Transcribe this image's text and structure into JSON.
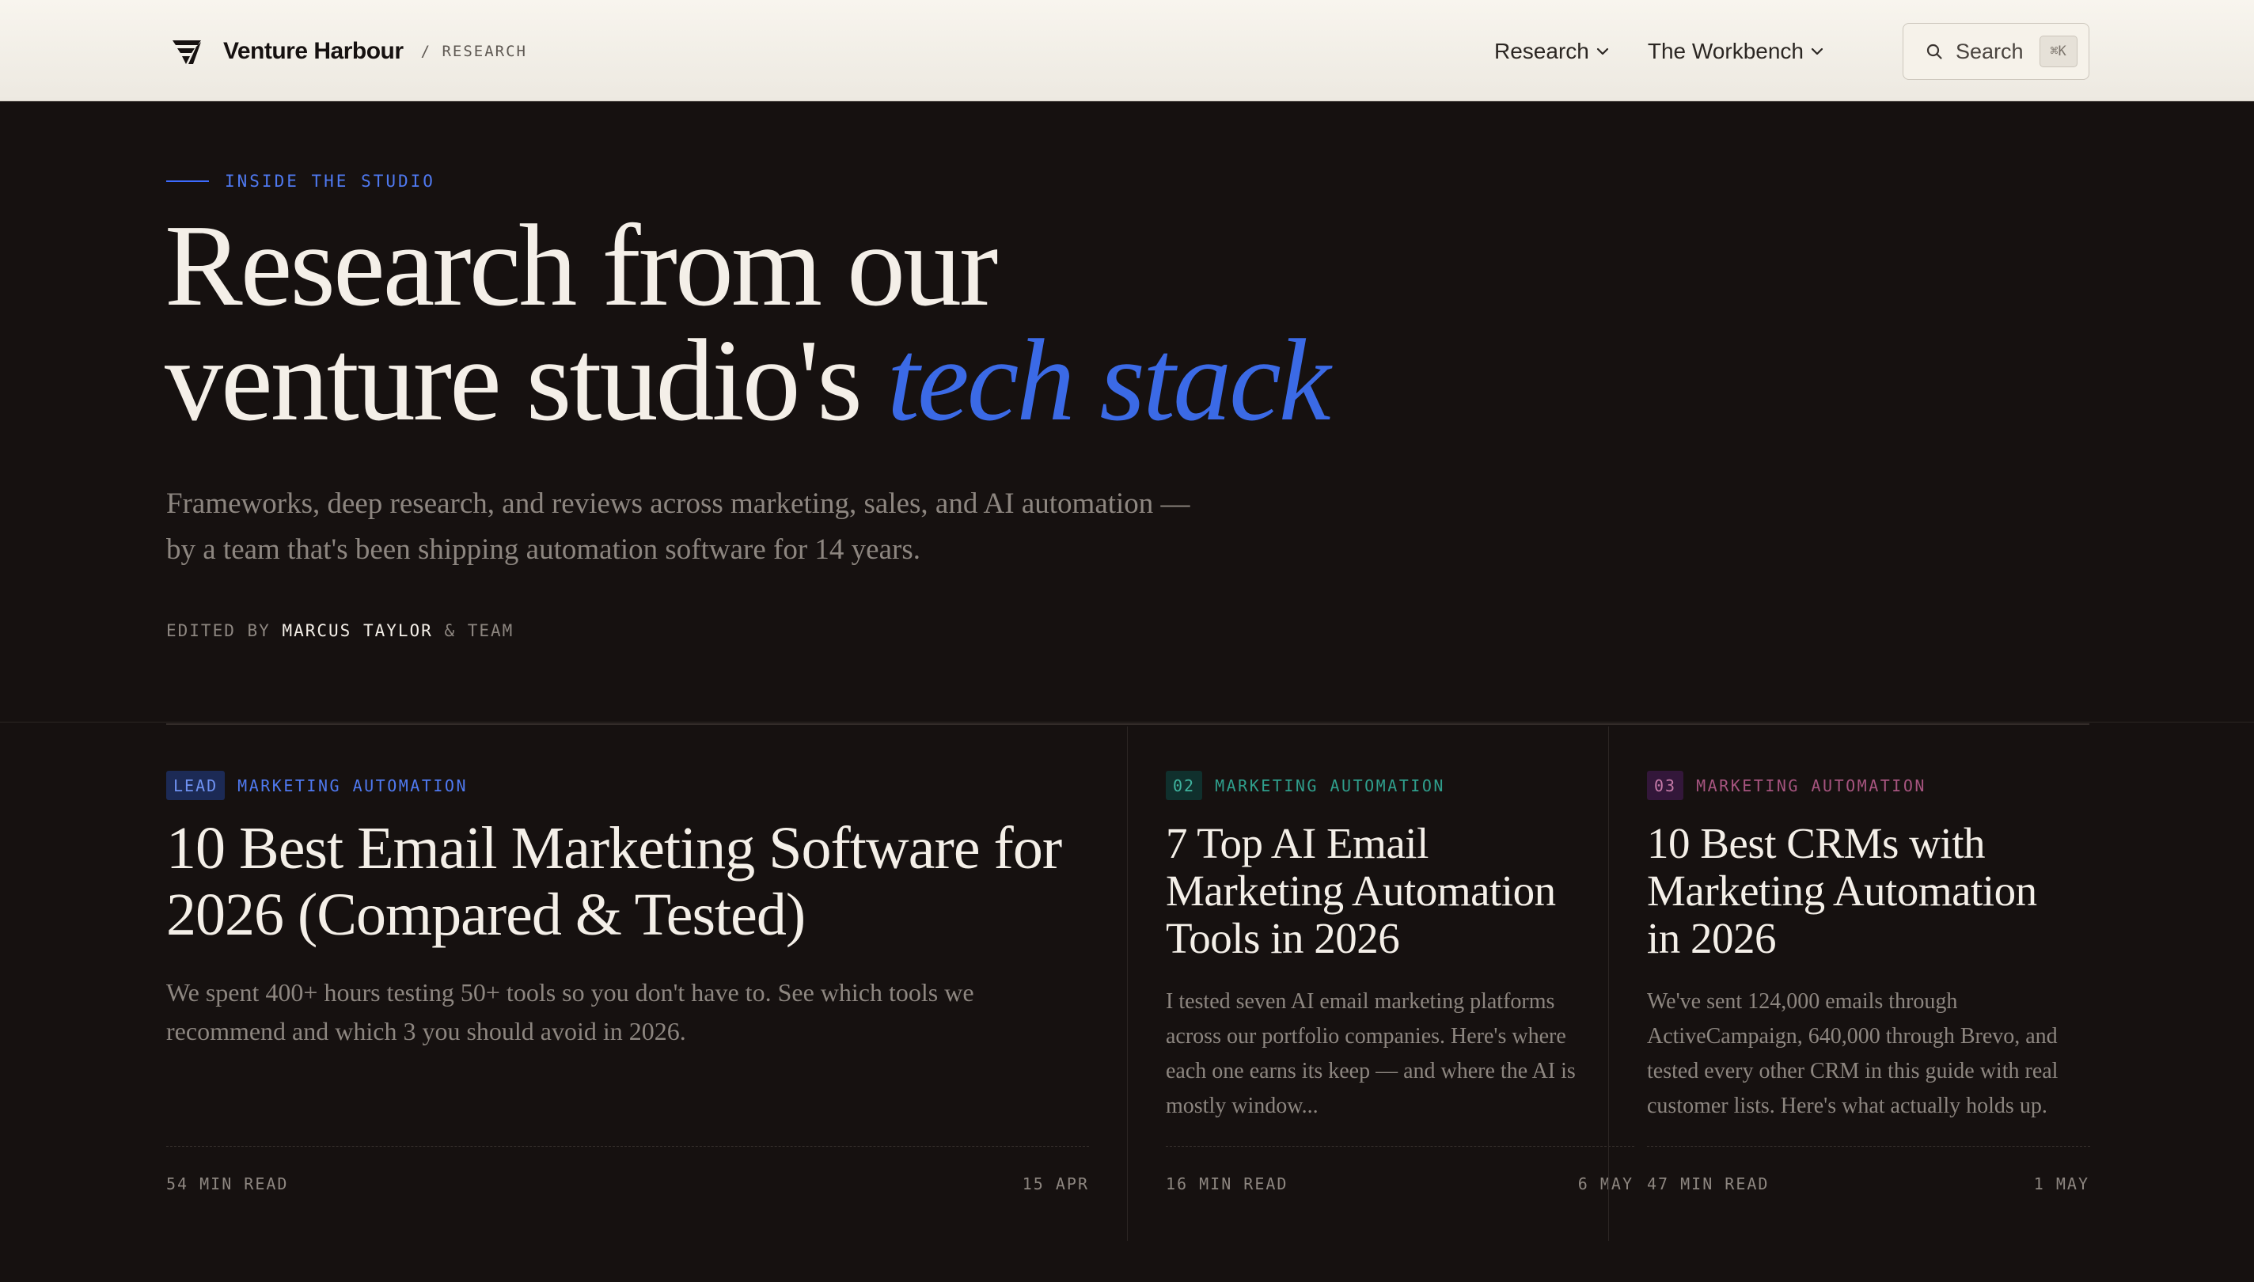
{
  "header": {
    "brand_name": "Venture Harbour",
    "section_label": "/ RESEARCH",
    "nav": [
      {
        "label": "Research"
      },
      {
        "label": "The Workbench"
      }
    ],
    "search": {
      "label": "Search",
      "shortcut": "⌘K"
    }
  },
  "hero": {
    "eyebrow": "INSIDE THE STUDIO",
    "title_line1": "Research from our",
    "title_line2_prefix": "venture studio's ",
    "title_accent": "tech stack",
    "subtitle": "Frameworks, deep research, and reviews across marketing, sales, and AI automation — by a team that's been shipping automation software for 14 years.",
    "byline_prefix": "EDITED BY ",
    "byline_name": "MARCUS TAYLOR",
    "byline_suffix": " & TEAM"
  },
  "articles": [
    {
      "badge": "LEAD",
      "category": "MARKETING AUTOMATION",
      "title": "10 Best Email Marketing Software for 2026 (Compared & Tested)",
      "excerpt": "We spent 400+ hours testing 50+ tools so you don't have to. See which tools we recommend and which 3 you should avoid in 2026.",
      "read_time": "54 MIN READ",
      "date": "15 APR"
    },
    {
      "badge": "02",
      "category": "MARKETING AUTOMATION",
      "title": "7 Top AI Email Marketing Automation Tools in 2026",
      "excerpt": "I tested seven AI email marketing platforms across our portfolio companies. Here's where each one earns its keep — and where the AI is mostly window...",
      "read_time": "16 MIN READ",
      "date": "6 MAY"
    },
    {
      "badge": "03",
      "category": "MARKETING AUTOMATION",
      "title": "10 Best CRMs with Marketing Automation in 2026",
      "excerpt": "We've sent 124,000 emails through ActiveCampaign, 640,000 through Brevo, and tested every other CRM in this guide with real customer lists. Here's what actually holds up.",
      "read_time": "47 MIN READ",
      "date": "1 MAY"
    }
  ],
  "colors": {
    "accent": "#3b6ae6",
    "background": "#161110",
    "header_background": "#f8f5ee",
    "teal": "#2f9e8c",
    "magenta": "#a6547f"
  },
  "icons": {
    "brand": "venture-harbour-logo-icon",
    "nav_dropdown": "chevron-down-icon",
    "search": "search-icon"
  }
}
